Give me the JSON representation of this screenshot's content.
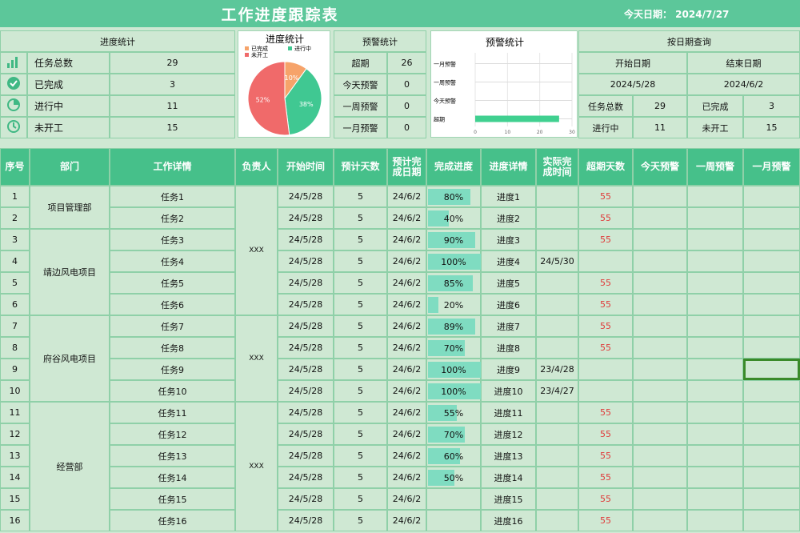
{
  "title": "工作进度跟踪表",
  "today": "今天日期：  2024/7/27",
  "progress_stats": {
    "header": "进度统计",
    "items": [
      {
        "label": "任务总数",
        "value": "29",
        "icon": "bar-chart-icon"
      },
      {
        "label": "已完成",
        "value": "3",
        "icon": "check-circle-icon"
      },
      {
        "label": "进行中",
        "value": "11",
        "icon": "pie-icon"
      },
      {
        "label": "未开工",
        "value": "15",
        "icon": "clock-icon"
      }
    ]
  },
  "pie_chart": {
    "title": "进度统计",
    "legend": [
      "已完成",
      "进行中",
      "未开工"
    ],
    "slice_labels": [
      "10%",
      "38%",
      "52%"
    ]
  },
  "warning_stats": {
    "header": "预警统计",
    "items": [
      {
        "label": "超期",
        "value": "26"
      },
      {
        "label": "今天预警",
        "value": "0"
      },
      {
        "label": "一周预警",
        "value": "0"
      },
      {
        "label": "一月预警",
        "value": "0"
      }
    ]
  },
  "warning_chart": {
    "title": "预警统计",
    "categories": [
      "一月预警",
      "一周预警",
      "今天预警",
      "超期"
    ],
    "x_ticks": [
      "0",
      "10",
      "20",
      "30"
    ]
  },
  "date_query": {
    "header": "按日期查询",
    "start_label": "开始日期",
    "end_label": "结束日期",
    "start_value": "2024/5/28",
    "end_value": "2024/6/2",
    "total_label": "任务总数",
    "total_value": "29",
    "done_label": "已完成",
    "done_value": "3",
    "ongoing_label": "进行中",
    "ongoing_value": "11",
    "notstarted_label": "未开工",
    "notstarted_value": "15"
  },
  "columns": [
    "序号",
    "部门",
    "工作详情",
    "负责人",
    "开始时间",
    "预计天数",
    "预计完成日期",
    "完成进度",
    "进度详情",
    "实际完成时间",
    "超期天数",
    "今天预警",
    "一周预警",
    "一月预警"
  ],
  "departments": [
    {
      "name": "项目管理部"
    },
    {
      "name": "靖边风电项目"
    },
    {
      "name": "府谷风电项目"
    },
    {
      "name": "经营部"
    }
  ],
  "owners": [
    "XXX",
    "XXX",
    "XXX"
  ],
  "rows": [
    {
      "no": "1",
      "task": "任务1",
      "start": "24/5/28",
      "days": "5",
      "due": "24/6/2",
      "progress": "80%",
      "pct": 0.8,
      "detail": "进度1",
      "actual": "",
      "overdue": "55"
    },
    {
      "no": "2",
      "task": "任务2",
      "start": "24/5/28",
      "days": "5",
      "due": "24/6/2",
      "progress": "40%",
      "pct": 0.4,
      "detail": "进度2",
      "actual": "",
      "overdue": "55"
    },
    {
      "no": "3",
      "task": "任务3",
      "start": "24/5/28",
      "days": "5",
      "due": "24/6/2",
      "progress": "90%",
      "pct": 0.9,
      "detail": "进度3",
      "actual": "",
      "overdue": "55"
    },
    {
      "no": "4",
      "task": "任务4",
      "start": "24/5/28",
      "days": "5",
      "due": "24/6/2",
      "progress": "100%",
      "pct": 1.0,
      "detail": "进度4",
      "actual": "24/5/30",
      "overdue": ""
    },
    {
      "no": "5",
      "task": "任务5",
      "start": "24/5/28",
      "days": "5",
      "due": "24/6/2",
      "progress": "85%",
      "pct": 0.85,
      "detail": "进度5",
      "actual": "",
      "overdue": "55"
    },
    {
      "no": "6",
      "task": "任务6",
      "start": "24/5/28",
      "days": "5",
      "due": "24/6/2",
      "progress": "20%",
      "pct": 0.2,
      "detail": "进度6",
      "actual": "",
      "overdue": "55"
    },
    {
      "no": "7",
      "task": "任务7",
      "start": "24/5/28",
      "days": "5",
      "due": "24/6/2",
      "progress": "89%",
      "pct": 0.89,
      "detail": "进度7",
      "actual": "",
      "overdue": "55"
    },
    {
      "no": "8",
      "task": "任务8",
      "start": "24/5/28",
      "days": "5",
      "due": "24/6/2",
      "progress": "70%",
      "pct": 0.7,
      "detail": "进度8",
      "actual": "",
      "overdue": "55"
    },
    {
      "no": "9",
      "task": "任务9",
      "start": "24/5/28",
      "days": "5",
      "due": "24/6/2",
      "progress": "100%",
      "pct": 1.0,
      "detail": "进度9",
      "actual": "23/4/28",
      "overdue": ""
    },
    {
      "no": "10",
      "task": "任务10",
      "start": "24/5/28",
      "days": "5",
      "due": "24/6/2",
      "progress": "100%",
      "pct": 1.0,
      "detail": "进度10",
      "actual": "23/4/27",
      "overdue": ""
    },
    {
      "no": "11",
      "task": "任务11",
      "start": "24/5/28",
      "days": "5",
      "due": "24/6/2",
      "progress": "55%",
      "pct": 0.55,
      "detail": "进度11",
      "actual": "",
      "overdue": "55"
    },
    {
      "no": "12",
      "task": "任务12",
      "start": "24/5/28",
      "days": "5",
      "due": "24/6/2",
      "progress": "70%",
      "pct": 0.7,
      "detail": "进度12",
      "actual": "",
      "overdue": "55"
    },
    {
      "no": "13",
      "task": "任务13",
      "start": "24/5/28",
      "days": "5",
      "due": "24/6/2",
      "progress": "60%",
      "pct": 0.6,
      "detail": "进度13",
      "actual": "",
      "overdue": "55"
    },
    {
      "no": "14",
      "task": "任务14",
      "start": "24/5/28",
      "days": "5",
      "due": "24/6/2",
      "progress": "50%",
      "pct": 0.5,
      "detail": "进度14",
      "actual": "",
      "overdue": "55"
    },
    {
      "no": "15",
      "task": "任务15",
      "start": "24/5/28",
      "days": "5",
      "due": "24/6/2",
      "progress": "",
      "pct": 0,
      "detail": "进度15",
      "actual": "",
      "overdue": "55"
    },
    {
      "no": "16",
      "task": "任务16",
      "start": "24/5/28",
      "days": "5",
      "due": "24/6/2",
      "progress": "",
      "pct": 0,
      "detail": "进度16",
      "actual": "",
      "overdue": "55"
    }
  ],
  "chart_data": [
    {
      "type": "pie",
      "title": "进度统计",
      "categories": [
        "已完成",
        "进行中",
        "未开工"
      ],
      "values": [
        10,
        38,
        52
      ],
      "colors": [
        "#f6a36a",
        "#40c892",
        "#f06a6a"
      ],
      "legend": "top"
    },
    {
      "type": "bar",
      "title": "预警统计",
      "categories": [
        "一月预警",
        "一周预警",
        "今天预警",
        "超期"
      ],
      "values": [
        0,
        0,
        0,
        26
      ],
      "xlim": [
        0,
        30
      ],
      "orientation": "horizontal",
      "color": "#40d090"
    }
  ],
  "colors": {
    "header": "#5cc79a",
    "table_header": "#46c08a",
    "sheet_bg": "#cfe8d3",
    "overdue": "#e03a3a",
    "progress_fill": "#7fdcc1"
  }
}
